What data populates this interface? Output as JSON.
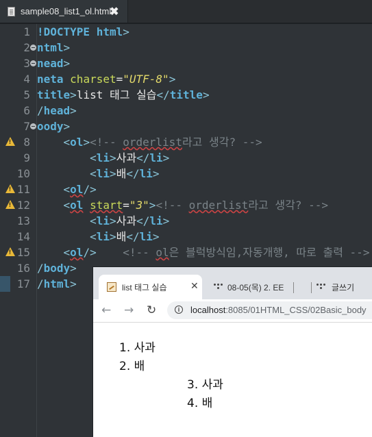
{
  "editor": {
    "tab_title": "sample08_list1_ol.html",
    "tab_close": "✖",
    "lines": [
      {
        "n": "1",
        "parts": [
          {
            "c": "t",
            "s": "!DOCTYPE html"
          },
          {
            "c": "p",
            "s": ">"
          }
        ]
      },
      {
        "n": "2",
        "parts": [
          {
            "c": "t",
            "s": "ntml"
          },
          {
            "c": "p",
            "s": ">"
          }
        ]
      },
      {
        "n": "3",
        "parts": [
          {
            "c": "t",
            "s": "nead"
          },
          {
            "c": "p",
            "s": ">"
          }
        ]
      },
      {
        "n": "4",
        "parts": [
          {
            "c": "t",
            "s": "neta "
          },
          {
            "c": "a",
            "s": "charset"
          },
          {
            "c": "x",
            "s": "="
          },
          {
            "c": "v",
            "s": "\"UTF-8\""
          },
          {
            "c": "p",
            "s": ">"
          }
        ]
      },
      {
        "n": "5",
        "parts": [
          {
            "c": "t",
            "s": "title"
          },
          {
            "c": "p",
            "s": ">"
          },
          {
            "c": "x",
            "s": "list 태그 실습"
          },
          {
            "c": "p",
            "s": "</"
          },
          {
            "c": "t",
            "s": "title"
          },
          {
            "c": "p",
            "s": ">"
          }
        ]
      },
      {
        "n": "6",
        "parts": [
          {
            "c": "p",
            "s": "/"
          },
          {
            "c": "t",
            "s": "head"
          },
          {
            "c": "p",
            "s": ">"
          }
        ]
      },
      {
        "n": "7",
        "parts": [
          {
            "c": "t",
            "s": "oody"
          },
          {
            "c": "p",
            "s": ">"
          }
        ]
      },
      {
        "n": "8",
        "parts": [
          {
            "c": "x",
            "s": "    "
          },
          {
            "c": "p",
            "s": "<"
          },
          {
            "c": "t",
            "s": "ol"
          },
          {
            "c": "p",
            "s": ">"
          },
          {
            "c": "c",
            "s": "<!-- "
          },
          {
            "c": "cu",
            "s": "orderlist"
          },
          {
            "c": "c",
            "s": "라고 생각? -->"
          }
        ]
      },
      {
        "n": "9",
        "parts": [
          {
            "c": "x",
            "s": "        "
          },
          {
            "c": "p",
            "s": "<"
          },
          {
            "c": "t",
            "s": "li"
          },
          {
            "c": "p",
            "s": ">"
          },
          {
            "c": "x",
            "s": "사과"
          },
          {
            "c": "p",
            "s": "</"
          },
          {
            "c": "t",
            "s": "li"
          },
          {
            "c": "p",
            "s": ">"
          }
        ]
      },
      {
        "n": "10",
        "parts": [
          {
            "c": "x",
            "s": "        "
          },
          {
            "c": "p",
            "s": "<"
          },
          {
            "c": "t",
            "s": "li"
          },
          {
            "c": "p",
            "s": ">"
          },
          {
            "c": "x",
            "s": "배"
          },
          {
            "c": "p",
            "s": "</"
          },
          {
            "c": "t",
            "s": "li"
          },
          {
            "c": "p",
            "s": ">"
          }
        ]
      },
      {
        "n": "11",
        "parts": [
          {
            "c": "x",
            "s": "    "
          },
          {
            "c": "p",
            "s": "<"
          },
          {
            "c": "tu",
            "s": "ol"
          },
          {
            "c": "p",
            "s": "/>"
          }
        ]
      },
      {
        "n": "12",
        "parts": [
          {
            "c": "x",
            "s": "    "
          },
          {
            "c": "p",
            "s": "<"
          },
          {
            "c": "tu",
            "s": "ol"
          },
          {
            "c": "x",
            "s": " "
          },
          {
            "c": "au",
            "s": "start"
          },
          {
            "c": "x",
            "s": "="
          },
          {
            "c": "v",
            "s": "\"3\""
          },
          {
            "c": "p",
            "s": ">"
          },
          {
            "c": "c",
            "s": "<!-- "
          },
          {
            "c": "cu",
            "s": "orderlist"
          },
          {
            "c": "c",
            "s": "라고 생각? -->"
          }
        ]
      },
      {
        "n": "13",
        "parts": [
          {
            "c": "x",
            "s": "        "
          },
          {
            "c": "p",
            "s": "<"
          },
          {
            "c": "t",
            "s": "li"
          },
          {
            "c": "p",
            "s": ">"
          },
          {
            "c": "x",
            "s": "사과"
          },
          {
            "c": "p",
            "s": "</"
          },
          {
            "c": "t",
            "s": "li"
          },
          {
            "c": "p",
            "s": ">"
          }
        ]
      },
      {
        "n": "14",
        "parts": [
          {
            "c": "x",
            "s": "        "
          },
          {
            "c": "p",
            "s": "<"
          },
          {
            "c": "t",
            "s": "li"
          },
          {
            "c": "p",
            "s": ">"
          },
          {
            "c": "x",
            "s": "배"
          },
          {
            "c": "p",
            "s": "</"
          },
          {
            "c": "t",
            "s": "li"
          },
          {
            "c": "p",
            "s": ">"
          }
        ]
      },
      {
        "n": "15",
        "parts": [
          {
            "c": "x",
            "s": "    "
          },
          {
            "c": "p",
            "s": "<"
          },
          {
            "c": "tu",
            "s": "ol"
          },
          {
            "c": "p",
            "s": "/>"
          },
          {
            "c": "c",
            "s": "    <!-- "
          },
          {
            "c": "cu",
            "s": "ol"
          },
          {
            "c": "c",
            "s": "은 블럭방식임,자동개행, 따로 출력 -->"
          }
        ]
      },
      {
        "n": "16",
        "parts": [
          {
            "c": "p",
            "s": "/"
          },
          {
            "c": "t",
            "s": "body"
          },
          {
            "c": "p",
            "s": ">"
          }
        ]
      },
      {
        "n": "17",
        "parts": [
          {
            "c": "p",
            "s": "/"
          },
          {
            "c": "t",
            "s": "html"
          },
          {
            "c": "p",
            "s": ">"
          }
        ]
      }
    ],
    "fold_lines": [
      "2",
      "3",
      "7"
    ],
    "warning_lines": [
      "8",
      "11",
      "12",
      "15"
    ],
    "current_line": "17"
  },
  "browser": {
    "active_tab": {
      "title": "list 태그 실습",
      "close": "✕"
    },
    "tab2": {
      "title": "08-05(목) 2. EE"
    },
    "tab3": {
      "title": "글쓰기"
    },
    "nav": {
      "back": "←",
      "forward": "→",
      "reload": "↻"
    },
    "url_host": "localhost",
    "url_rest": ":8085/01HTML_CSS/02Basic_body",
    "list1": [
      {
        "num": "1.",
        "text": "사과"
      },
      {
        "num": "2.",
        "text": "배"
      }
    ],
    "list2": [
      {
        "num": "3.",
        "text": "사과"
      },
      {
        "num": "4.",
        "text": "배"
      }
    ]
  }
}
